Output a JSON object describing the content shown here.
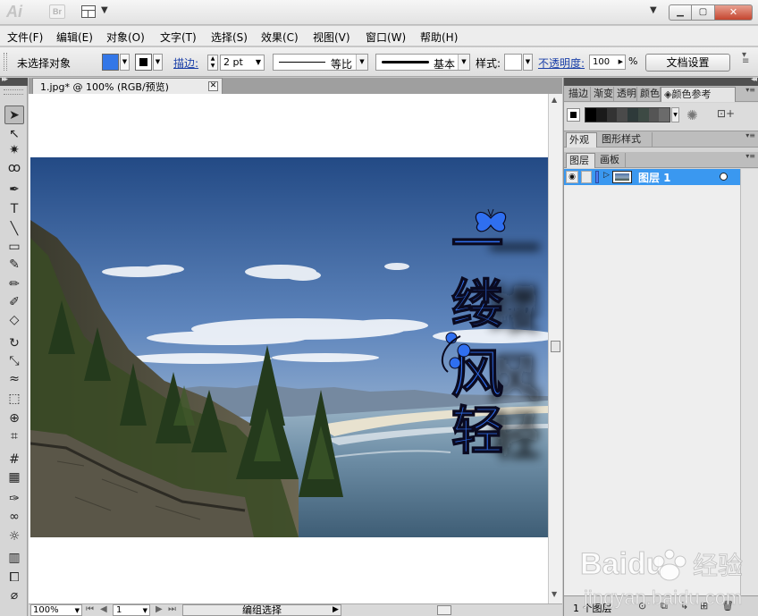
{
  "app": {
    "logo": "Ai",
    "bridge": "Br"
  },
  "menu": [
    "文件(F)",
    "编辑(E)",
    "对象(O)",
    "文字(T)",
    "选择(S)",
    "效果(C)",
    "视图(V)",
    "窗口(W)",
    "帮助(H)"
  ],
  "controlbar": {
    "selection": "未选择对象",
    "fill_color": "#3377e8",
    "stroke_color": "#000000",
    "stroke_label": "描边:",
    "stroke_weight": "2 pt",
    "profile": "等比",
    "brush": "基本",
    "style_label": "样式:",
    "opacity_label": "不透明度:",
    "opacity_value": "100",
    "opacity_unit": "%",
    "doc_setup": "文档设置"
  },
  "document": {
    "tab_title": "1.jpg* @ 100% (RGB/预览)",
    "artwork_text": [
      "一",
      "缕",
      "风",
      "轻"
    ],
    "text_color": "#2f6ff0"
  },
  "tools": [
    "selection-tool",
    "direct-selection-tool",
    "magic-wand-tool",
    "lasso-tool",
    "pen-tool",
    "type-tool",
    "line-tool",
    "rectangle-tool",
    "paintbrush-tool",
    "pencil-tool",
    "blob-brush-tool",
    "eraser-tool",
    "rotate-tool",
    "scale-tool",
    "warp-tool",
    "free-transform-tool",
    "shape-builder-tool",
    "perspective-grid-tool",
    "mesh-tool",
    "gradient-tool",
    "eyedropper-tool",
    "blend-tool",
    "symbol-sprayer-tool",
    "column-graph-tool",
    "artboard-tool",
    "slice-tool"
  ],
  "tool_glyphs": {
    "type-tool": "T"
  },
  "statusbar": {
    "zoom": "100%",
    "artboard": "1",
    "info": "编组选择"
  },
  "panels": {
    "top_tabs": [
      "描边",
      "渐变",
      "透明",
      "颜色",
      "颜色参考"
    ],
    "harmony_colors": [
      "#000000",
      "#1a1a1a",
      "#333333",
      "#4a4a4a",
      "#2e3a3a",
      "#3d4a44",
      "#555555",
      "#6b6b6b"
    ],
    "appearance_tabs": [
      "外观",
      "图形样式"
    ],
    "layers_tabs": [
      "图层",
      "画板"
    ],
    "layer_name": "图层 1",
    "layer_count": "1 个图层"
  },
  "watermark": {
    "brand": "Baidu",
    "chinese": "经验",
    "url": "jingyan.baidu.com"
  }
}
